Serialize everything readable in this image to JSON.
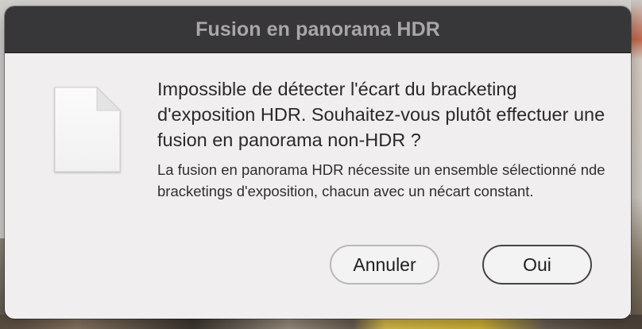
{
  "dialog": {
    "title": "Fusion en panorama HDR",
    "icon": "document-icon",
    "headline": "Impossible de détecter l'écart du bracketing d'exposition HDR. Souhaitez-vous plutôt effectuer une fusion en panorama non-HDR ?",
    "message": "La fusion en panorama HDR nécessite un ensemble sélectionné nde bracketings d'exposition, chacun avec un nécart constant.",
    "buttons": {
      "cancel": "Annuler",
      "ok": "Oui"
    }
  }
}
